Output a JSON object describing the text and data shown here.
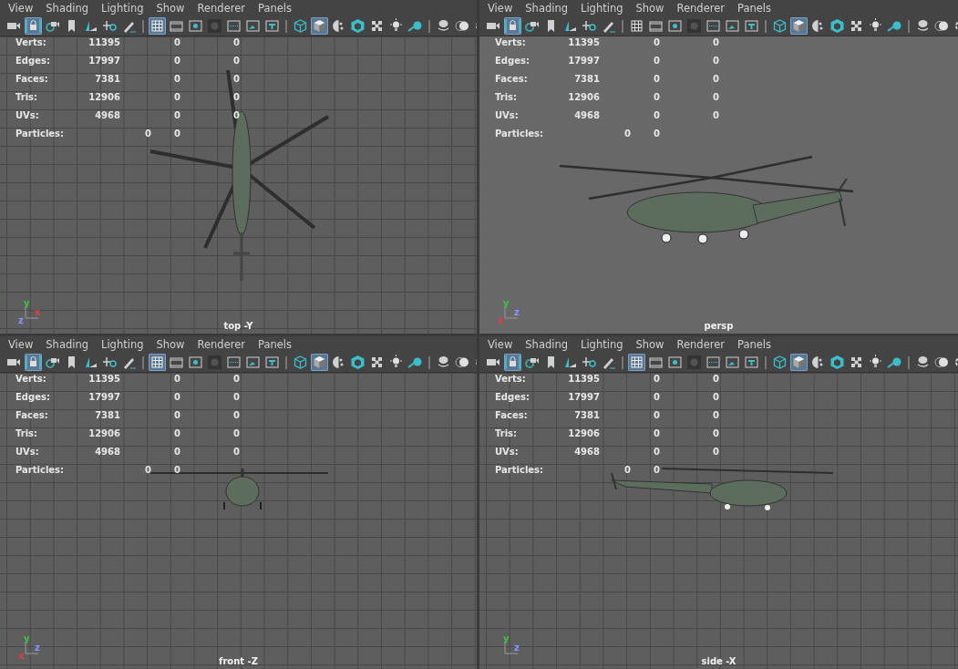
{
  "panes": [
    {
      "kind": "top",
      "camera": "top -Y",
      "menu": [
        "View",
        "Shading",
        "Lighting",
        "Show",
        "Renderer",
        "Panels"
      ],
      "toolbar": [
        {
          "kind": "camera",
          "selected": false
        },
        {
          "kind": "camera-lock",
          "selected": true
        },
        {
          "kind": "camera-gear",
          "selected": false
        },
        {
          "kind": "bookmark",
          "selected": false
        },
        {
          "kind": "image-plane",
          "selected": false
        },
        {
          "kind": "pan",
          "selected": false
        },
        {
          "kind": "pencil",
          "selected": false
        },
        {
          "kind": "separator"
        },
        {
          "kind": "grid",
          "selected": true
        },
        {
          "kind": "film",
          "selected": false
        },
        {
          "kind": "dot",
          "selected": false
        },
        {
          "kind": "dark-dot",
          "selected": false
        },
        {
          "kind": "dotted-frame",
          "selected": false
        },
        {
          "kind": "picture",
          "selected": false
        },
        {
          "kind": "text-frame",
          "selected": false
        },
        {
          "kind": "separator"
        },
        {
          "kind": "wire-cube",
          "selected": false
        },
        {
          "kind": "solid-cube",
          "selected": true
        },
        {
          "kind": "half-circle",
          "selected": false
        },
        {
          "kind": "hex-cube",
          "selected": false
        },
        {
          "kind": "checker",
          "selected": false
        },
        {
          "kind": "bulb",
          "selected": false
        },
        {
          "kind": "sphere",
          "selected": false
        },
        {
          "kind": "separator"
        },
        {
          "kind": "layers",
          "selected": false
        },
        {
          "kind": "double-circle",
          "selected": false
        },
        {
          "kind": "ring",
          "selected": false
        }
      ],
      "stats": [
        {
          "kind": "count",
          "label": "Verts:",
          "values": [
            "11395",
            "0",
            "0"
          ]
        },
        {
          "kind": "count",
          "label": "Edges:",
          "values": [
            "17997",
            "0",
            "0"
          ]
        },
        {
          "kind": "count",
          "label": "Faces:",
          "values": [
            "7381",
            "0",
            "0"
          ]
        },
        {
          "kind": "count",
          "label": "Tris:",
          "values": [
            "12906",
            "0",
            "0"
          ]
        },
        {
          "kind": "count",
          "label": "UVs:",
          "values": [
            "4968",
            "0",
            "0"
          ]
        },
        {
          "kind": "particles",
          "label": "Particles:",
          "values": [
            "0",
            "0"
          ]
        }
      ],
      "axes": [
        {
          "label": "y",
          "color": "#3ec43e"
        },
        {
          "label": "x",
          "color": "#e04040"
        },
        {
          "label": "z",
          "color": "#8a96ff"
        }
      ]
    },
    {
      "kind": "persp",
      "camera": "persp",
      "menu": [
        "View",
        "Shading",
        "Lighting",
        "Show",
        "Renderer",
        "Panels"
      ],
      "toolbar": [
        {
          "kind": "camera",
          "selected": false
        },
        {
          "kind": "camera-lock",
          "selected": true
        },
        {
          "kind": "camera-gear",
          "selected": false
        },
        {
          "kind": "bookmark",
          "selected": false
        },
        {
          "kind": "image-plane",
          "selected": false
        },
        {
          "kind": "pan",
          "selected": false
        },
        {
          "kind": "pencil",
          "selected": false
        },
        {
          "kind": "separator"
        },
        {
          "kind": "grid",
          "selected": false
        },
        {
          "kind": "film",
          "selected": false
        },
        {
          "kind": "dot",
          "selected": false
        },
        {
          "kind": "dark-dot",
          "selected": false
        },
        {
          "kind": "dotted-frame",
          "selected": false
        },
        {
          "kind": "picture",
          "selected": false
        },
        {
          "kind": "text-frame",
          "selected": false
        },
        {
          "kind": "separator"
        },
        {
          "kind": "wire-cube",
          "selected": false
        },
        {
          "kind": "solid-cube",
          "selected": true
        },
        {
          "kind": "half-circle",
          "selected": false
        },
        {
          "kind": "hex-cube",
          "selected": false
        },
        {
          "kind": "checker",
          "selected": false
        },
        {
          "kind": "bulb",
          "selected": false
        },
        {
          "kind": "sphere",
          "selected": false
        },
        {
          "kind": "separator"
        },
        {
          "kind": "layers",
          "selected": false
        },
        {
          "kind": "double-circle",
          "selected": false
        },
        {
          "kind": "ring",
          "selected": false
        }
      ],
      "stats": [
        {
          "kind": "count",
          "label": "Verts:",
          "values": [
            "11395",
            "0",
            "0"
          ]
        },
        {
          "kind": "count",
          "label": "Edges:",
          "values": [
            "17997",
            "0",
            "0"
          ]
        },
        {
          "kind": "count",
          "label": "Faces:",
          "values": [
            "7381",
            "0",
            "0"
          ]
        },
        {
          "kind": "count",
          "label": "Tris:",
          "values": [
            "12906",
            "0",
            "0"
          ]
        },
        {
          "kind": "count",
          "label": "UVs:",
          "values": [
            "4968",
            "0",
            "0"
          ]
        },
        {
          "kind": "particles",
          "label": "Particles:",
          "values": [
            "0",
            "0"
          ]
        }
      ],
      "axes": [
        {
          "label": "y",
          "color": "#3ec43e"
        },
        {
          "label": "z",
          "color": "#8a96ff"
        },
        {
          "label": "x",
          "color": "#e04040"
        }
      ]
    },
    {
      "kind": "front",
      "camera": "front -Z",
      "menu": [
        "View",
        "Shading",
        "Lighting",
        "Show",
        "Renderer",
        "Panels"
      ],
      "toolbar": [
        {
          "kind": "camera",
          "selected": false
        },
        {
          "kind": "camera-lock",
          "selected": true
        },
        {
          "kind": "camera-gear",
          "selected": false
        },
        {
          "kind": "bookmark",
          "selected": false
        },
        {
          "kind": "image-plane",
          "selected": false
        },
        {
          "kind": "pan",
          "selected": false
        },
        {
          "kind": "pencil",
          "selected": false
        },
        {
          "kind": "separator"
        },
        {
          "kind": "grid",
          "selected": true
        },
        {
          "kind": "film",
          "selected": false
        },
        {
          "kind": "dot",
          "selected": false
        },
        {
          "kind": "dark-dot",
          "selected": false
        },
        {
          "kind": "dotted-frame",
          "selected": false
        },
        {
          "kind": "picture",
          "selected": false
        },
        {
          "kind": "text-frame",
          "selected": false
        },
        {
          "kind": "separator"
        },
        {
          "kind": "wire-cube",
          "selected": false
        },
        {
          "kind": "solid-cube",
          "selected": true
        },
        {
          "kind": "half-circle",
          "selected": false
        },
        {
          "kind": "hex-cube",
          "selected": false
        },
        {
          "kind": "checker",
          "selected": false
        },
        {
          "kind": "bulb",
          "selected": false
        },
        {
          "kind": "sphere",
          "selected": false
        },
        {
          "kind": "separator"
        },
        {
          "kind": "layers",
          "selected": false
        },
        {
          "kind": "double-circle",
          "selected": false
        },
        {
          "kind": "ring",
          "selected": false
        }
      ],
      "stats": [
        {
          "kind": "count",
          "label": "Verts:",
          "values": [
            "11395",
            "0",
            "0"
          ]
        },
        {
          "kind": "count",
          "label": "Edges:",
          "values": [
            "17997",
            "0",
            "0"
          ]
        },
        {
          "kind": "count",
          "label": "Faces:",
          "values": [
            "7381",
            "0",
            "0"
          ]
        },
        {
          "kind": "count",
          "label": "Tris:",
          "values": [
            "12906",
            "0",
            "0"
          ]
        },
        {
          "kind": "count",
          "label": "UVs:",
          "values": [
            "4968",
            "0",
            "0"
          ]
        },
        {
          "kind": "particles",
          "label": "Particles:",
          "values": [
            "0",
            "0"
          ]
        }
      ],
      "axes": [
        {
          "label": "y",
          "color": "#3ec43e"
        },
        {
          "label": "z",
          "color": "#8a96ff"
        },
        {
          "label": "x",
          "color": "#e04040"
        }
      ]
    },
    {
      "kind": "side",
      "camera": "side -X",
      "menu": [
        "View",
        "Shading",
        "Lighting",
        "Show",
        "Renderer",
        "Panels"
      ],
      "toolbar": [
        {
          "kind": "camera",
          "selected": false
        },
        {
          "kind": "camera-lock",
          "selected": true
        },
        {
          "kind": "camera-gear",
          "selected": false
        },
        {
          "kind": "bookmark",
          "selected": false
        },
        {
          "kind": "image-plane",
          "selected": false
        },
        {
          "kind": "pan",
          "selected": false
        },
        {
          "kind": "pencil",
          "selected": false
        },
        {
          "kind": "separator"
        },
        {
          "kind": "grid",
          "selected": true
        },
        {
          "kind": "film",
          "selected": false
        },
        {
          "kind": "dot",
          "selected": false
        },
        {
          "kind": "dark-dot",
          "selected": false
        },
        {
          "kind": "dotted-frame",
          "selected": false
        },
        {
          "kind": "picture",
          "selected": false
        },
        {
          "kind": "text-frame",
          "selected": false
        },
        {
          "kind": "separator"
        },
        {
          "kind": "wire-cube",
          "selected": false
        },
        {
          "kind": "solid-cube",
          "selected": true
        },
        {
          "kind": "half-circle",
          "selected": false
        },
        {
          "kind": "hex-cube",
          "selected": false
        },
        {
          "kind": "checker",
          "selected": false
        },
        {
          "kind": "bulb",
          "selected": false
        },
        {
          "kind": "sphere",
          "selected": false
        },
        {
          "kind": "separator"
        },
        {
          "kind": "layers",
          "selected": false
        },
        {
          "kind": "double-circle",
          "selected": false
        },
        {
          "kind": "ring",
          "selected": false
        }
      ],
      "stats": [
        {
          "kind": "count",
          "label": "Verts:",
          "values": [
            "11395",
            "0",
            "0"
          ]
        },
        {
          "kind": "count",
          "label": "Edges:",
          "values": [
            "17997",
            "0",
            "0"
          ]
        },
        {
          "kind": "count",
          "label": "Faces:",
          "values": [
            "7381",
            "0",
            "0"
          ]
        },
        {
          "kind": "count",
          "label": "Tris:",
          "values": [
            "12906",
            "0",
            "0"
          ]
        },
        {
          "kind": "count",
          "label": "UVs:",
          "values": [
            "4968",
            "0",
            "0"
          ]
        },
        {
          "kind": "particles",
          "label": "Particles:",
          "values": [
            "0",
            "0"
          ]
        }
      ],
      "axes": [
        {
          "label": "y",
          "color": "#3ec43e"
        },
        {
          "label": "z",
          "color": "#8a96ff"
        }
      ]
    }
  ]
}
